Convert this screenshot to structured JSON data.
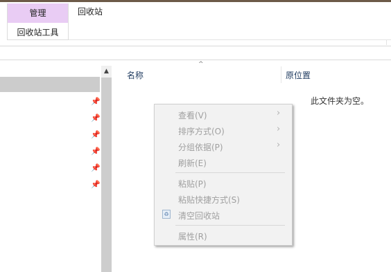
{
  "ribbon": {
    "manage_tab_label": "管理",
    "contextual_tab_label": "回收站工具",
    "window_title": "回收站"
  },
  "content": {
    "columns": [
      {
        "label": "名称"
      },
      {
        "label": "原位置"
      }
    ],
    "empty_message": "此文件夹为空。"
  },
  "context_menu": {
    "items": [
      {
        "label": "查看(V)",
        "submenu": true,
        "enabled": false
      },
      {
        "label": "排序方式(O)",
        "submenu": true,
        "enabled": false
      },
      {
        "label": "分组依据(P)",
        "submenu": true,
        "enabled": false
      },
      {
        "label": "刷新(E)",
        "submenu": false,
        "enabled": false
      },
      {
        "label": "粘贴(P)",
        "submenu": false,
        "enabled": false
      },
      {
        "label": "粘贴快捷方式(S)",
        "submenu": false,
        "enabled": false
      },
      {
        "label": "清空回收站",
        "submenu": false,
        "enabled": false,
        "icon": "recycle-bin-icon"
      },
      {
        "label": "属性(R)",
        "submenu": false,
        "enabled": false
      }
    ]
  },
  "nav_pane": {
    "pinned_count": 6
  },
  "colors": {
    "manage_tab_bg": "#e9ccf4",
    "selected_nav_bg": "#cccccc",
    "scrollbar_bg": "#cdcdcd",
    "menu_bg": "#f2f2f2"
  }
}
